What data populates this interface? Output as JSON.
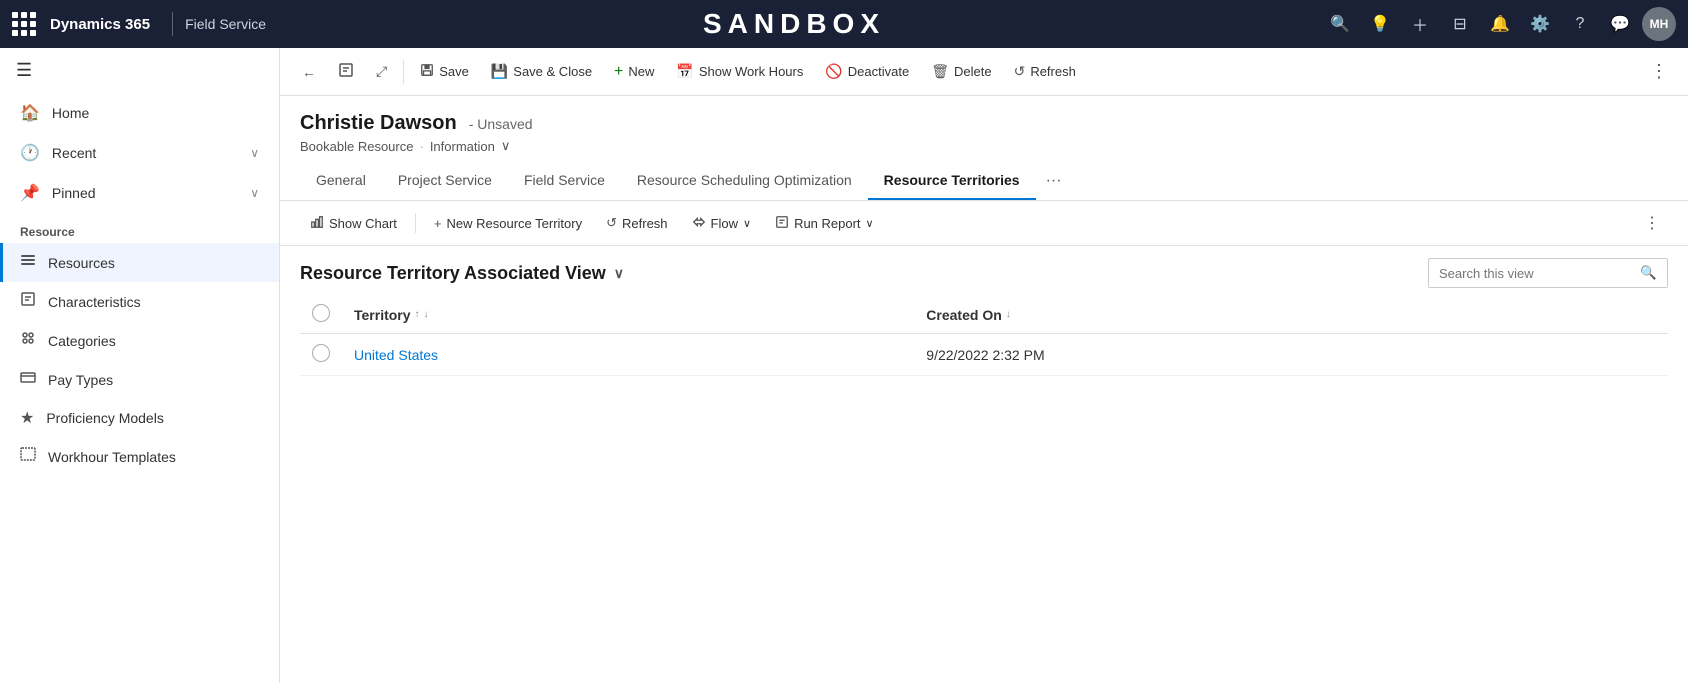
{
  "topnav": {
    "waffle_label": "App launcher",
    "brand": "Dynamics 365",
    "app_name": "Field Service",
    "sandbox_title": "SANDBOX",
    "icons": [
      "search",
      "lightbulb",
      "plus",
      "filter",
      "bell",
      "gear",
      "help",
      "chat"
    ],
    "avatar_initials": "MH"
  },
  "sidebar": {
    "hamburger_label": "Collapse",
    "nav": [
      {
        "label": "Home",
        "icon": "🏠"
      },
      {
        "label": "Recent",
        "icon": "🕐",
        "has_chevron": true
      },
      {
        "label": "Pinned",
        "icon": "📌",
        "has_chevron": true
      }
    ],
    "section_title": "Resource",
    "resources": [
      {
        "label": "Resources",
        "icon": "👤",
        "active": true
      },
      {
        "label": "Characteristics",
        "icon": "📋",
        "active": false
      },
      {
        "label": "Categories",
        "icon": "👥",
        "active": false
      },
      {
        "label": "Pay Types",
        "icon": "📄",
        "active": false
      },
      {
        "label": "Proficiency Models",
        "icon": "⭐",
        "active": false
      },
      {
        "label": "Workhour Templates",
        "icon": "⏰",
        "active": false
      }
    ]
  },
  "commandbar": {
    "back_label": "Back",
    "save_label": "Save",
    "save_close_label": "Save & Close",
    "new_label": "New",
    "show_work_hours_label": "Show Work Hours",
    "deactivate_label": "Deactivate",
    "delete_label": "Delete",
    "refresh_label": "Refresh"
  },
  "record": {
    "name": "Christie Dawson",
    "unsaved": "- Unsaved",
    "entity": "Bookable Resource",
    "form_name": "Information"
  },
  "tabs": [
    {
      "label": "General",
      "active": false
    },
    {
      "label": "Project Service",
      "active": false
    },
    {
      "label": "Field Service",
      "active": false
    },
    {
      "label": "Resource Scheduling Optimization",
      "active": false
    },
    {
      "label": "Resource Territories",
      "active": true
    }
  ],
  "subtoolbar": {
    "show_chart_label": "Show Chart",
    "new_resource_territory_label": "New Resource Territory",
    "refresh_label": "Refresh",
    "flow_label": "Flow",
    "run_report_label": "Run Report"
  },
  "view": {
    "title": "Resource Territory Associated View",
    "search_placeholder": "Search this view"
  },
  "table": {
    "columns": [
      {
        "label": "Territory",
        "sortable": true,
        "sort_dir": "asc"
      },
      {
        "label": "Created On",
        "sortable": true,
        "sort_dir": "desc"
      }
    ],
    "rows": [
      {
        "territory": "United States",
        "territory_link": true,
        "created_on": "9/22/2022 2:32 PM"
      }
    ]
  }
}
